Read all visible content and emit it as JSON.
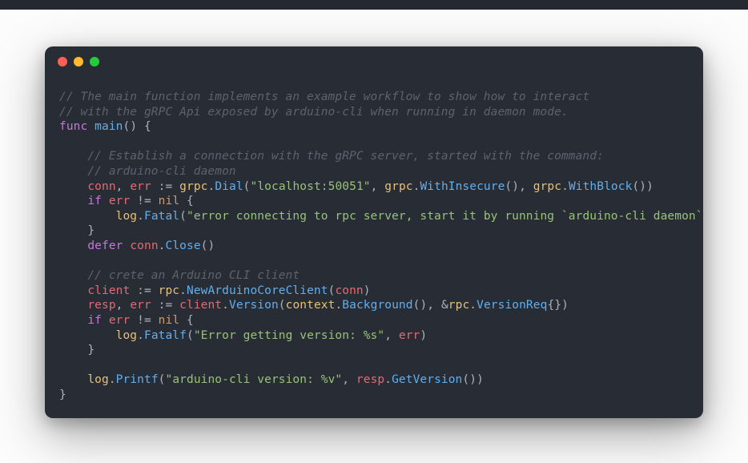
{
  "code": {
    "c1": "// The main function implements an example workflow to show how to interact",
    "c2": "// with the gRPC Api exposed by arduino-cli when running in daemon mode.",
    "kw_func": "func",
    "fn_main": "main",
    "paren_oc": "()",
    "brace_o": " {",
    "c3": "// Establish a connection with the gRPC server, started with the command:",
    "c4": "// arduino-cli daemon",
    "v_conn": "conn",
    "comma_err": ", ",
    "v_err": "err",
    "assign": " := ",
    "ns_grpc": "grpc",
    "dot": ".",
    "fn_dial": "Dial",
    "lp": "(",
    "rp": ")",
    "s_addr": "\"localhost:50051\"",
    "fn_withins": "WithInsecure",
    "fn_withblk": "WithBlock",
    "kw_if": "if",
    "neq": " != ",
    "nil": "nil",
    "ns_log": "log",
    "fn_fatal": "Fatal",
    "s_err1": "\"error connecting to rpc server, start it by running `arduino-cli daemon`\"",
    "brace_c": "}",
    "kw_defer": "defer",
    "fn_close": "Close",
    "c5": "// crete an Arduino CLI client",
    "v_client": "client",
    "ns_rpc": "rpc",
    "fn_newacc": "NewArduinoCoreClient",
    "v_resp": "resp",
    "fn_version": "Version",
    "ns_ctx": "context",
    "fn_bg": "Background",
    "amp": ", &",
    "t_verreq": "VersionReq",
    "braces_e": "{}",
    "fn_fatalf": "Fatalf",
    "s_err2": "\"Error getting version: %s\"",
    "fn_printf": "Printf",
    "s_ver": "\"arduino-cli version: %v\"",
    "fn_getver": "GetVersion",
    "sp": " ",
    "comma": ", "
  }
}
